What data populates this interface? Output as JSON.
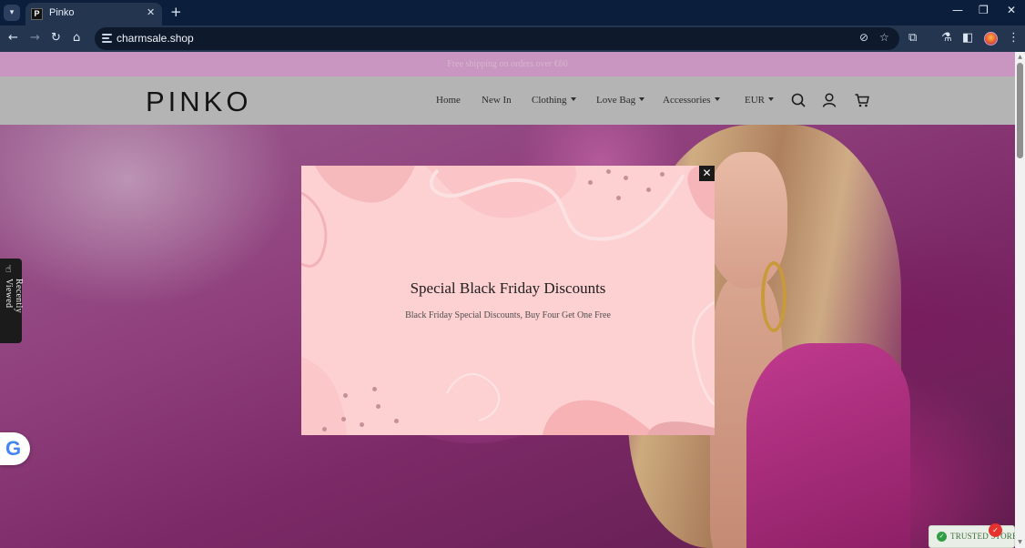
{
  "browser": {
    "tab_title": "Pinko",
    "tab_favicon_letter": "P",
    "url": "charmsale.shop",
    "icons": {
      "tab_list": "chevron-down-icon",
      "tab_close": "close-icon",
      "new_tab": "plus-icon",
      "minimize": "minimize-icon",
      "restore": "restore-icon",
      "close_window": "close-icon",
      "back": "back-arrow-icon",
      "forward": "forward-arrow-icon",
      "reload": "reload-icon",
      "home": "home-icon",
      "site_info": "tune-icon",
      "eye_off": "eye-off-icon",
      "bookmark": "star-icon",
      "extensions": "puzzle-icon",
      "labs": "flask-icon",
      "side_panel": "side-panel-icon",
      "menu": "kebab-menu-icon"
    }
  },
  "site": {
    "announcement": "Free shipping on orders over €60",
    "logo": "PINKO",
    "nav": [
      {
        "label": "Home",
        "dropdown": false
      },
      {
        "label": "New In",
        "dropdown": false
      },
      {
        "label": "Clothing",
        "dropdown": true
      },
      {
        "label": "Love Bag",
        "dropdown": true
      },
      {
        "label": "Accessories",
        "dropdown": true
      }
    ],
    "currency": "EUR",
    "header_icons": [
      "search-icon",
      "account-icon",
      "cart-icon"
    ],
    "recently_viewed_label": "Recently Viewed",
    "google_badge_letter": "G",
    "trusted_store_label": "TRUSTED STORE"
  },
  "popup": {
    "title": "Special Black Friday Discounts",
    "subtitle": "Black Friday Special Discounts, Buy Four Get One Free",
    "close_icon": "close-icon"
  },
  "colors": {
    "announcement_bg": "#c896c0",
    "header_bg": "#b4b4b4",
    "popup_bg": "#fdd0d2"
  }
}
